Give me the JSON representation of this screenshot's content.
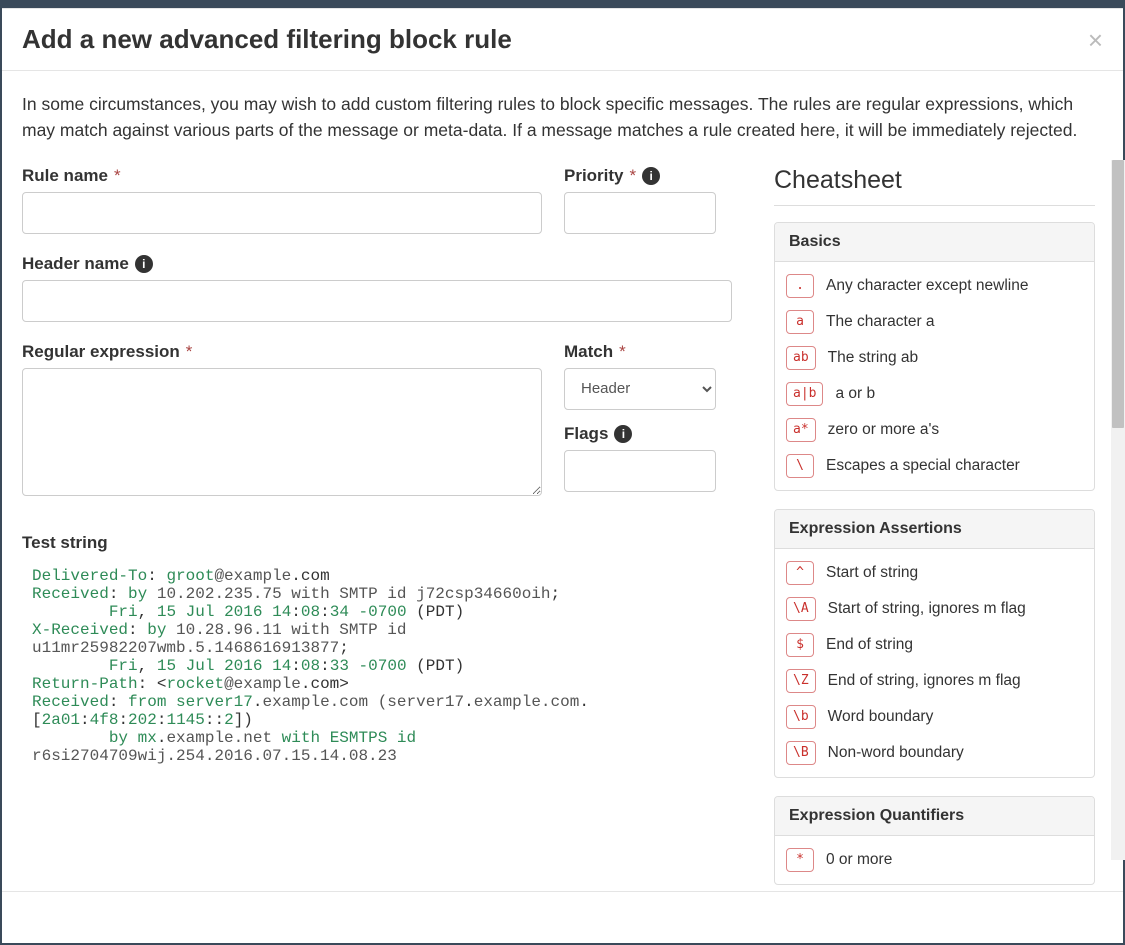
{
  "modal": {
    "title": "Add a new advanced filtering block rule",
    "intro": "In some circumstances, you may wish to add custom filtering rules to block specific messages. The rules are regular expressions, which may match against various parts of the message or meta-data. If a message matches a rule created here, it will be immediately rejected."
  },
  "fields": {
    "rule_name_label": "Rule name",
    "priority_label": "Priority",
    "header_name_label": "Header name",
    "regex_label": "Regular expression",
    "match_label": "Match",
    "match_value": "Header",
    "flags_label": "Flags",
    "test_string_label": "Test string"
  },
  "test_string_html": "<span class='tok-key'>Delivered-To</span><span class='tok-punct'>:</span> <span class='tok-val'>groot</span><span class='tok-grey'>@example</span><span class='tok-punct'>.com</span>\n<span class='tok-key'>Received</span><span class='tok-punct'>:</span> <span class='tok-val'>by</span> <span class='tok-grey'>10.202.235.75 with SMTP id j72csp34660oih</span><span class='tok-punct'>;</span>\n        <span class='tok-val'>Fri</span><span class='tok-punct'>,</span> <span class='tok-val'>15</span> <span class='tok-val'>Jul</span> <span class='tok-val'>2016</span> <span class='tok-val'>14</span><span class='tok-punct'>:</span><span class='tok-val'>08</span><span class='tok-punct'>:</span><span class='tok-val'>34</span> <span class='tok-val'>-0700</span> <span class='tok-punct'>(PDT)</span>\n<span class='tok-key'>X-Received</span><span class='tok-punct'>:</span> <span class='tok-val'>by</span> <span class='tok-grey'>10.28.96.11 with SMTP id</span> <span class='tok-grey'>u11mr25982207wmb.5.1468616913877</span><span class='tok-punct'>;</span>\n        <span class='tok-val'>Fri</span><span class='tok-punct'>,</span> <span class='tok-val'>15</span> <span class='tok-val'>Jul</span> <span class='tok-val'>2016</span> <span class='tok-val'>14</span><span class='tok-punct'>:</span><span class='tok-val'>08</span><span class='tok-punct'>:</span><span class='tok-val'>33</span> <span class='tok-val'>-0700</span> <span class='tok-punct'>(PDT)</span>\n<span class='tok-key'>Return-Path</span><span class='tok-punct'>:</span> <span class='tok-punct'>&lt;</span><span class='tok-val'>rocket</span><span class='tok-grey'>@example</span><span class='tok-punct'>.com&gt;</span>\n<span class='tok-key'>Received</span><span class='tok-punct'>:</span> <span class='tok-val'>from</span> <span class='tok-val'>server17</span><span class='tok-punct'>.</span><span class='tok-grey'>example.com (server17</span><span class='tok-punct'>.</span><span class='tok-grey'>example.com</span><span class='tok-punct'>.</span> <span class='tok-punct'>[</span><span class='tok-val'>2a01</span><span class='tok-punct'>:</span><span class='tok-val'>4f8</span><span class='tok-punct'>:</span><span class='tok-val'>202</span><span class='tok-punct'>:</span><span class='tok-val'>1145</span><span class='tok-punct'>::</span><span class='tok-val'>2</span><span class='tok-punct'>])</span>\n        <span class='tok-val'>by</span> <span class='tok-val'>mx</span><span class='tok-punct'>.</span><span class='tok-grey'>example.net</span> <span class='tok-val'>with</span> <span class='tok-val'>ESMTPS</span> <span class='tok-val'>id</span> <span class='tok-grey'>r6si2704709wij.254.2016.07.15.14.08.23</span>",
  "cheatsheet": {
    "title": "Cheatsheet",
    "sections": [
      {
        "name": "Basics",
        "rows": [
          {
            "tok": ".",
            "desc": "Any character except newline"
          },
          {
            "tok": "a",
            "desc": "The character a"
          },
          {
            "tok": "ab",
            "desc": "The string ab"
          },
          {
            "tok": "a|b",
            "desc": "a or b"
          },
          {
            "tok": "a*",
            "desc": "zero or more a's"
          },
          {
            "tok": "\\",
            "desc": "Escapes a special character"
          }
        ]
      },
      {
        "name": "Expression Assertions",
        "rows": [
          {
            "tok": "^",
            "desc": "Start of string"
          },
          {
            "tok": "\\A",
            "desc": "Start of string, ignores m flag"
          },
          {
            "tok": "$",
            "desc": "End of string"
          },
          {
            "tok": "\\Z",
            "desc": "End of string, ignores m flag"
          },
          {
            "tok": "\\b",
            "desc": "Word boundary"
          },
          {
            "tok": "\\B",
            "desc": "Non-word boundary"
          }
        ]
      },
      {
        "name": "Expression Quantifiers",
        "rows": [
          {
            "tok": "*",
            "desc": "0 or more"
          }
        ]
      }
    ]
  }
}
